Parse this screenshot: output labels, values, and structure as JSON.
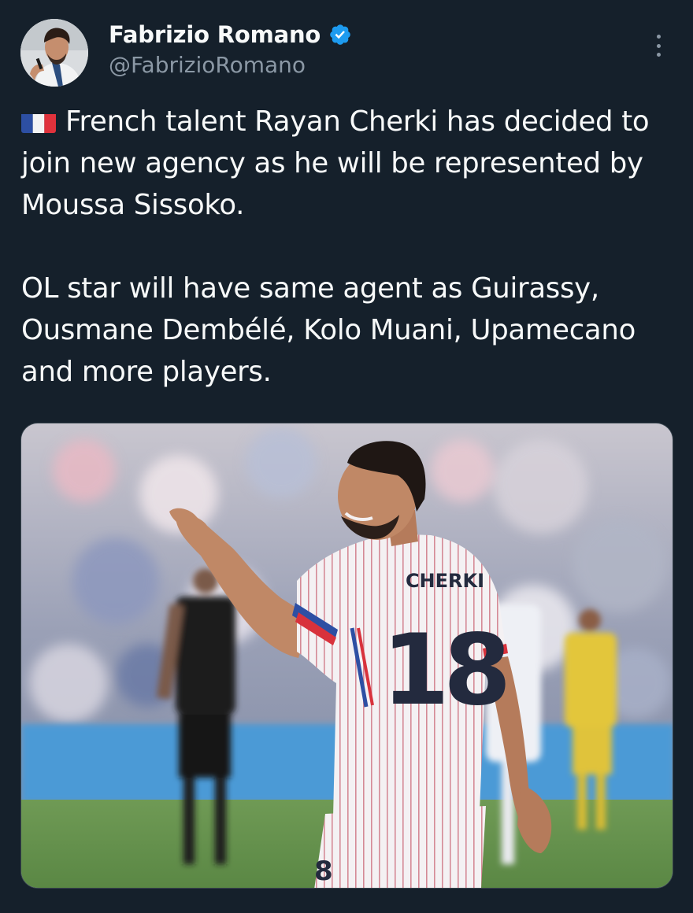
{
  "author": {
    "display_name": "Fabrizio Romano",
    "handle": "@FabrizioRomano",
    "verified": true,
    "avatar_icon": "profile-photo"
  },
  "tweet": {
    "flag_icon": "france-flag-emoji",
    "lines": [
      "French talent Rayan Cherki has decided to join new agency as he will be represented by Moussa Sissoko.",
      "OL star will have same agent as Guirassy, Ousmane Dembélé, Kolo Muani, Upamecano and more players."
    ]
  },
  "media": {
    "jersey_name": "CHERKI",
    "jersey_number": "18",
    "shorts_number": "8"
  },
  "colors": {
    "background": "#15202b",
    "text_primary": "#f7f9f9",
    "text_secondary": "#8b98a5",
    "verified_blue": "#1d9bf0"
  }
}
